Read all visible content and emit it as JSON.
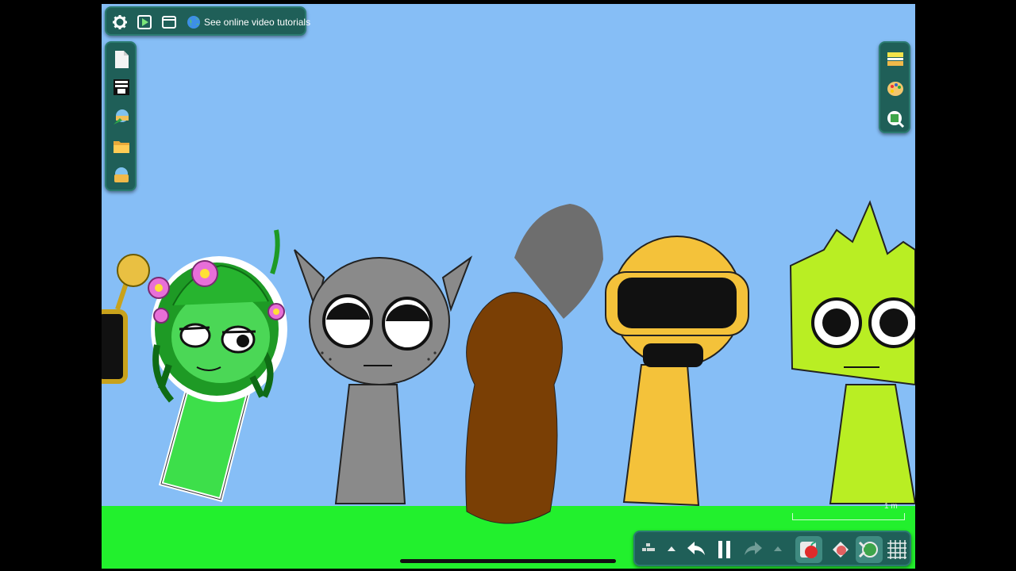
{
  "top_bar": {
    "settings_icon": "gear-icon",
    "play_icon": "play-icon",
    "window_icon": "window-icon",
    "tutorials_label": "See online video tutorials"
  },
  "left_toolbar": {
    "items": [
      "new-file-icon",
      "layers-icon",
      "add-scene-icon",
      "open-folder-icon",
      "import-icon"
    ]
  },
  "right_toolbar": {
    "items": [
      "properties-icon",
      "palette-icon",
      "zoom-add-icon"
    ]
  },
  "bottom_bar": {
    "items": [
      "grid-menu-icon",
      "expand-up-icon",
      "undo-icon",
      "pause-icon",
      "redo-icon",
      "expand-up-icon",
      "apple-tool-icon",
      "shape-tool-icon",
      "connect-tool-icon",
      "grid-toggle-icon"
    ]
  },
  "scale": {
    "label": "1 m"
  },
  "colors": {
    "sky": "#86bef6",
    "ground": "#22f02d",
    "toolbar": "#1f5f58"
  }
}
